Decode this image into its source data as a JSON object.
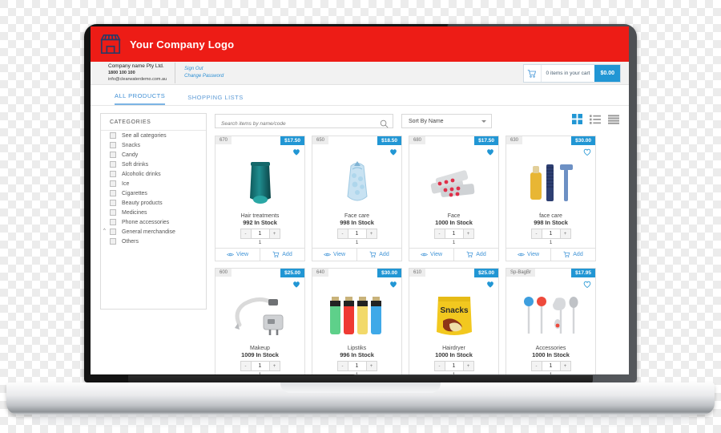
{
  "brand": {
    "logo_icon": "storefront-icon",
    "name": "Your Company Logo",
    "bar_color": "#ed1c16"
  },
  "account": {
    "company": "Company name  Pty Ltd.",
    "phone": "1800 100 100",
    "email": "info@clearwaterdemo.com.au",
    "links": [
      "Sign Out",
      "Change Password"
    ]
  },
  "cart": {
    "icon": "shopping-cart-icon",
    "items_label": "0 items in your cart",
    "total": "$0.00",
    "accent": "#2196d4"
  },
  "tabs": [
    {
      "label": "ALL PRODUCTS",
      "active": true
    },
    {
      "label": "SHOPPING LISTS",
      "active": false
    }
  ],
  "sidebar": {
    "title": "CATEGORIES",
    "items": [
      {
        "label": "See all categories",
        "chevron": false
      },
      {
        "label": "Snacks",
        "chevron": false
      },
      {
        "label": "Candy",
        "chevron": false
      },
      {
        "label": "Soft drinks",
        "chevron": false
      },
      {
        "label": "Alcoholic drinks",
        "chevron": false
      },
      {
        "label": "Ice",
        "chevron": false
      },
      {
        "label": "Cigarettes",
        "chevron": false
      },
      {
        "label": "Beauty products",
        "chevron": false
      },
      {
        "label": "Medicines",
        "chevron": false
      },
      {
        "label": "Phone accessories",
        "chevron": false
      },
      {
        "label": "General merchandise",
        "chevron": true
      },
      {
        "label": "Others",
        "chevron": false
      }
    ]
  },
  "toolbar": {
    "search_placeholder": "Search items by name/code",
    "search_value": "",
    "search_icon": "search-icon",
    "sort_label": "Sort By Name",
    "view_modes": [
      {
        "name": "grid-view-icon",
        "active": true
      },
      {
        "name": "list-view-icon",
        "active": false
      },
      {
        "name": "compact-view-icon",
        "active": false
      }
    ]
  },
  "card_actions": {
    "view_label": "View",
    "add_label": "Add",
    "view_icon": "eye-icon",
    "add_icon": "cart-add-icon",
    "minus": "-",
    "plus": "+"
  },
  "products": [
    {
      "code": "670",
      "price": "$17.50",
      "name": "Hair treatments",
      "stock": "992 In Stock",
      "qty": "1",
      "subqty": "1",
      "favorite": true,
      "art": "tube"
    },
    {
      "code": "650",
      "price": "$18.50",
      "name": "Face care",
      "stock": "998 In Stock",
      "qty": "1",
      "subqty": "1",
      "favorite": true,
      "art": "icebag"
    },
    {
      "code": "680",
      "price": "$17.50",
      "name": "Face",
      "stock": "1000 In Stock",
      "qty": "1",
      "subqty": "1",
      "favorite": true,
      "art": "pills"
    },
    {
      "code": "630",
      "price": "$30.00",
      "name": "face care",
      "stock": "998 In Stock",
      "qty": "1",
      "subqty": "1",
      "favorite": false,
      "art": "toiletry"
    },
    {
      "code": "600",
      "price": "$25.00",
      "name": "Makeup",
      "stock": "1009 In Stock",
      "qty": "1",
      "subqty": "1",
      "favorite": true,
      "art": "charger"
    },
    {
      "code": "640",
      "price": "$30.00",
      "name": "Lipstiks",
      "stock": "996 In Stock",
      "qty": "1",
      "subqty": "1",
      "favorite": true,
      "art": "lighters"
    },
    {
      "code": "610",
      "price": "$25.00",
      "name": "Hairdryer",
      "stock": "1000 In Stock",
      "qty": "1",
      "subqty": "1",
      "favorite": true,
      "art": "snacks"
    },
    {
      "code": "Sp-BagBr",
      "price": "$17.95",
      "name": "Accessories",
      "stock": "1000 In Stock",
      "qty": "1",
      "subqty": "1",
      "favorite": false,
      "art": "earphones"
    }
  ]
}
